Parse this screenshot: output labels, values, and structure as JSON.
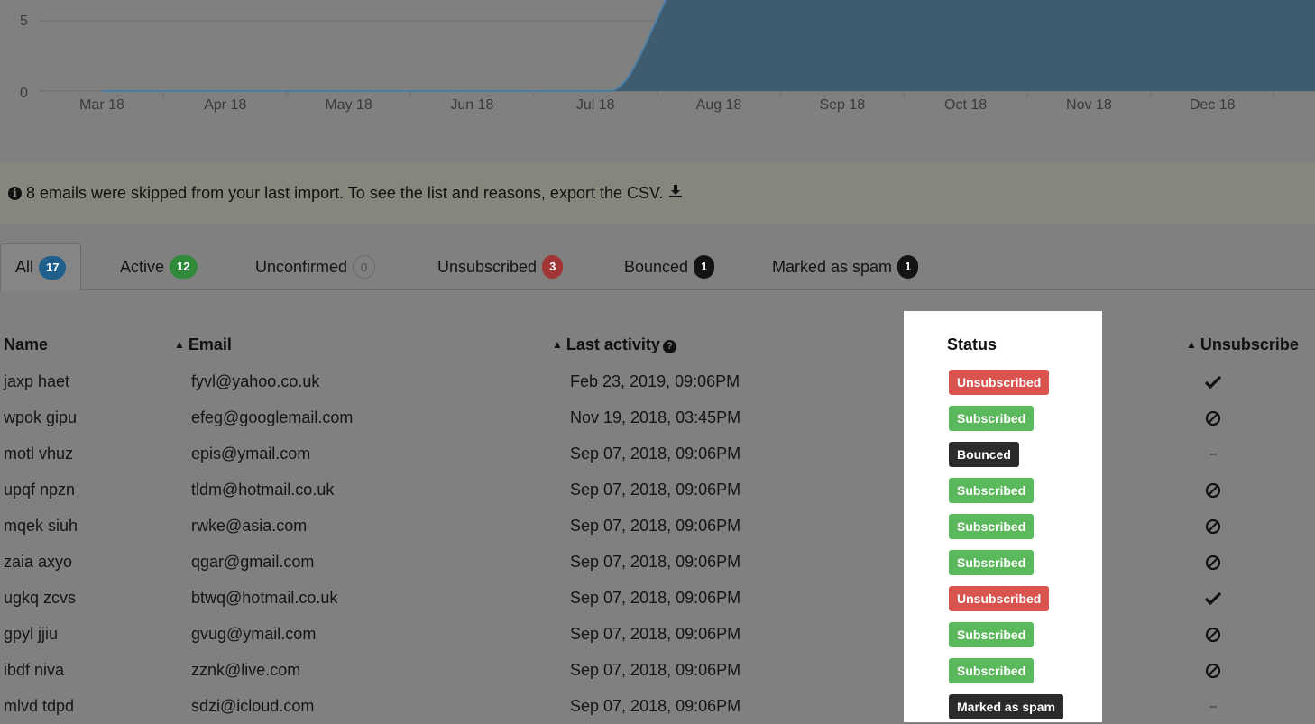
{
  "chart": {
    "y_ticks": [
      "5",
      "0"
    ],
    "x_ticks": [
      "Mar 18",
      "Apr 18",
      "May 18",
      "Jun 18",
      "Jul 18",
      "Aug 18",
      "Sep 18",
      "Oct 18",
      "Nov 18",
      "Dec 18"
    ],
    "fill_color": "#3f5c6f",
    "line_color": "#4a7fa7"
  },
  "notice": {
    "text": "8 emails were skipped from your last import. To see the list and reasons, export the CSV."
  },
  "tabs": [
    {
      "label": "All",
      "count": "17",
      "style": "blue"
    },
    {
      "label": "Active",
      "count": "12",
      "style": "green"
    },
    {
      "label": "Unconfirmed",
      "count": "0",
      "style": "outline"
    },
    {
      "label": "Unsubscribed",
      "count": "3",
      "style": "red"
    },
    {
      "label": "Bounced",
      "count": "1",
      "style": "dark"
    },
    {
      "label": "Marked as spam",
      "count": "1",
      "style": "dark"
    }
  ],
  "table": {
    "headers": {
      "name": "Name",
      "email": "Email",
      "last_activity": "Last activity",
      "status": "Status",
      "unsubscribe": "Unsubscribe"
    },
    "rows": [
      {
        "name": "jaxp haet",
        "email": "fyvl@yahoo.co.uk",
        "last_activity": "Feb 23, 2019, 09:06PM",
        "status": "Unsubscribed",
        "status_type": "unsub",
        "unsub": "check"
      },
      {
        "name": "wpok gipu",
        "email": "efeg@googlemail.com",
        "last_activity": "Nov 19, 2018, 03:45PM",
        "status": "Subscribed",
        "status_type": "sub",
        "unsub": "ban"
      },
      {
        "name": "motl vhuz",
        "email": "epis@ymail.com",
        "last_activity": "Sep 07, 2018, 09:06PM",
        "status": "Bounced",
        "status_type": "dark",
        "unsub": "dash"
      },
      {
        "name": "upqf npzn",
        "email": "tldm@hotmail.co.uk",
        "last_activity": "Sep 07, 2018, 09:06PM",
        "status": "Subscribed",
        "status_type": "sub",
        "unsub": "ban"
      },
      {
        "name": "mqek siuh",
        "email": "rwke@asia.com",
        "last_activity": "Sep 07, 2018, 09:06PM",
        "status": "Subscribed",
        "status_type": "sub",
        "unsub": "ban"
      },
      {
        "name": "zaia axyo",
        "email": "qgar@gmail.com",
        "last_activity": "Sep 07, 2018, 09:06PM",
        "status": "Subscribed",
        "status_type": "sub",
        "unsub": "ban"
      },
      {
        "name": "ugkq zcvs",
        "email": "btwq@hotmail.co.uk",
        "last_activity": "Sep 07, 2018, 09:06PM",
        "status": "Unsubscribed",
        "status_type": "unsub",
        "unsub": "check"
      },
      {
        "name": "gpyl jjiu",
        "email": "gvug@ymail.com",
        "last_activity": "Sep 07, 2018, 09:06PM",
        "status": "Subscribed",
        "status_type": "sub",
        "unsub": "ban"
      },
      {
        "name": "ibdf niva",
        "email": "zznk@live.com",
        "last_activity": "Sep 07, 2018, 09:06PM",
        "status": "Subscribed",
        "status_type": "sub",
        "unsub": "ban"
      },
      {
        "name": "mlvd tdpd",
        "email": "sdzi@icloud.com",
        "last_activity": "Sep 07, 2018, 09:06PM",
        "status": "Marked as spam",
        "status_type": "dark",
        "unsub": "dash"
      }
    ]
  },
  "icons": {
    "info": "info-circle-icon",
    "download": "download-icon",
    "sort": "sort-icon",
    "help": "question-circle-icon",
    "check": "check-icon",
    "ban": "ban-icon",
    "dash": "dash-icon"
  }
}
